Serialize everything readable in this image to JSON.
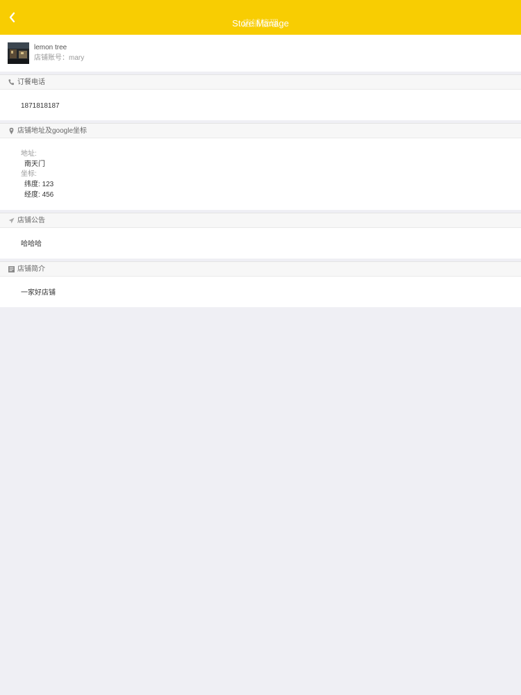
{
  "header": {
    "title_en": "Store Manage",
    "title_zh": "店铺管理",
    "back_icon": "chevron-left-icon"
  },
  "store": {
    "name": "lemon tree",
    "account_label": "店铺账号：",
    "account": "mary"
  },
  "sections": {
    "phone": {
      "icon": "phone-icon",
      "label": "订餐电话",
      "value": "1871818187"
    },
    "address": {
      "icon": "location-pin-icon",
      "label": "店铺地址及google坐标",
      "address_label": "地址:",
      "address_value": "南天门",
      "coords_label": "坐标:",
      "lat_label": "纬度:",
      "lat_value": "123",
      "lng_label": "经度:",
      "lng_value": "456"
    },
    "notice": {
      "icon": "send-icon",
      "label": "店铺公告",
      "value": "哈哈哈"
    },
    "intro": {
      "icon": "book-icon",
      "label": "店铺简介",
      "value": "一家好店铺"
    }
  },
  "colors": {
    "header_bg": "#f8cd02",
    "page_bg": "#efeff4"
  }
}
